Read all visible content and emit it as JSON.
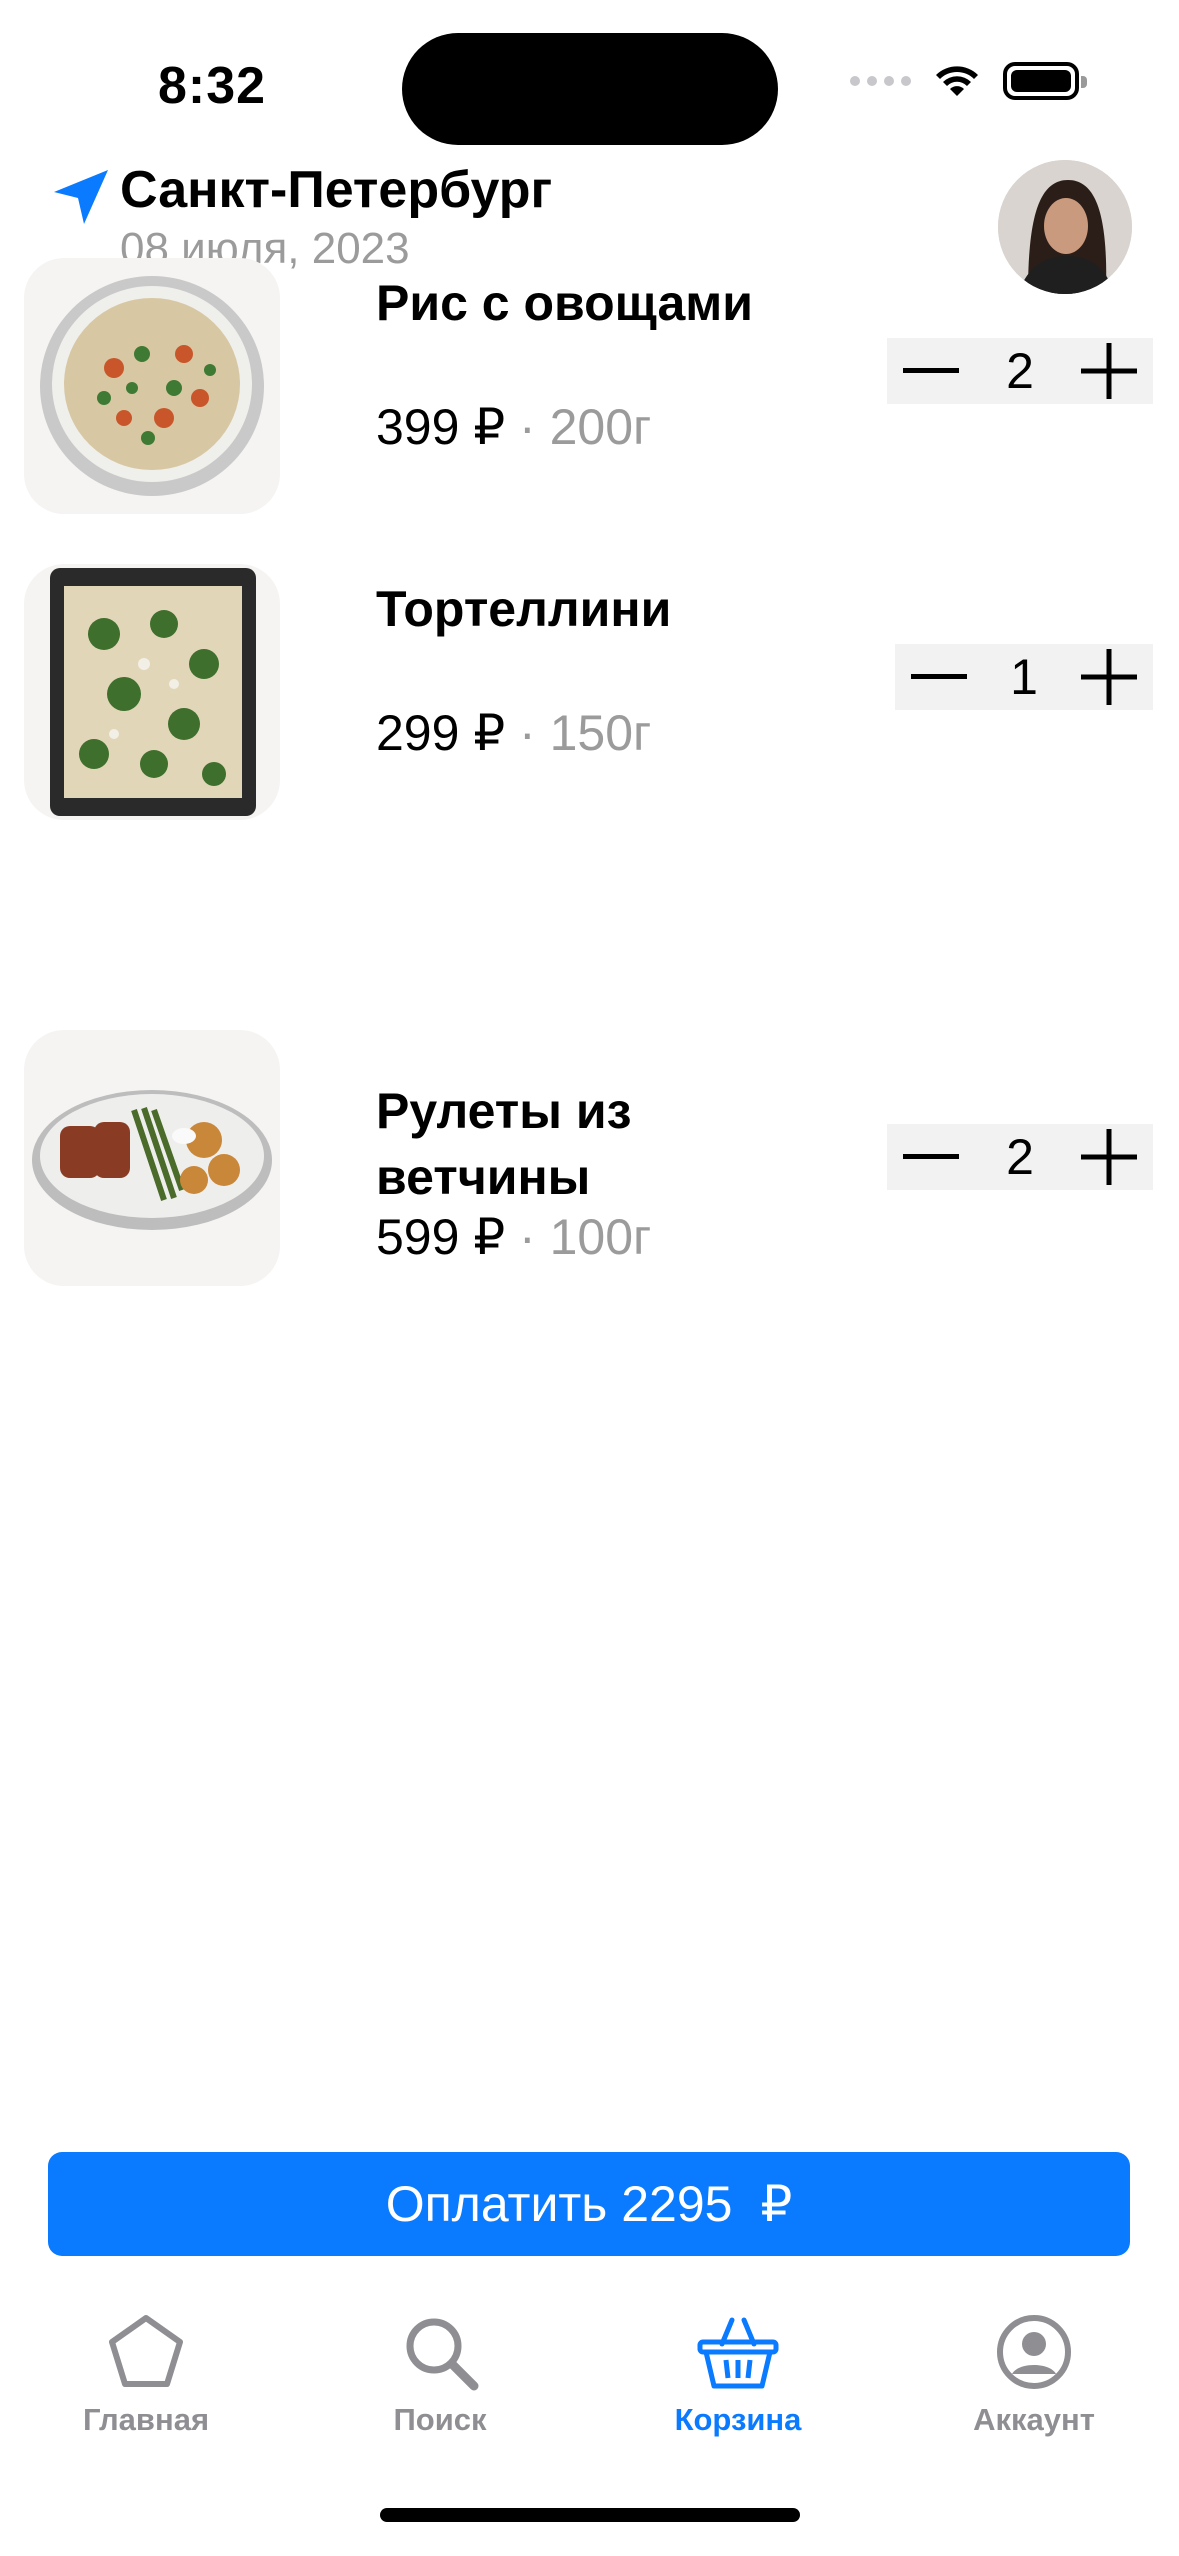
{
  "status_bar": {
    "time": "8:32"
  },
  "header": {
    "city": "Санкт-Петербург",
    "date": "08 июля, 2023",
    "location_icon": "location-arrow-icon",
    "accent": "#0a7aff"
  },
  "cart": {
    "items": [
      {
        "name": "Рис с овощами",
        "price": "399 ₽",
        "weight": " · 200г",
        "quantity": "2",
        "image": "rice-with-vegetables-photo"
      },
      {
        "name": "Тортеллини",
        "price": "299 ₽",
        "weight": " · 150г",
        "quantity": "1",
        "image": "tortellini-photo"
      },
      {
        "name": "Рулеты из ветчины",
        "price": "599 ₽",
        "weight": " · 100г",
        "quantity": "2",
        "image": "ham-rolls-photo"
      }
    ]
  },
  "pay_button": {
    "label": "Оплатить 2295",
    "currency": "₽"
  },
  "tabbar": {
    "tabs": [
      {
        "label": "Главная",
        "icon": "pentagon-icon",
        "active": false
      },
      {
        "label": "Поиск",
        "icon": "search-icon",
        "active": false
      },
      {
        "label": "Корзина",
        "icon": "basket-icon",
        "active": true
      },
      {
        "label": "Аккаунт",
        "icon": "account-icon",
        "active": false
      }
    ]
  }
}
